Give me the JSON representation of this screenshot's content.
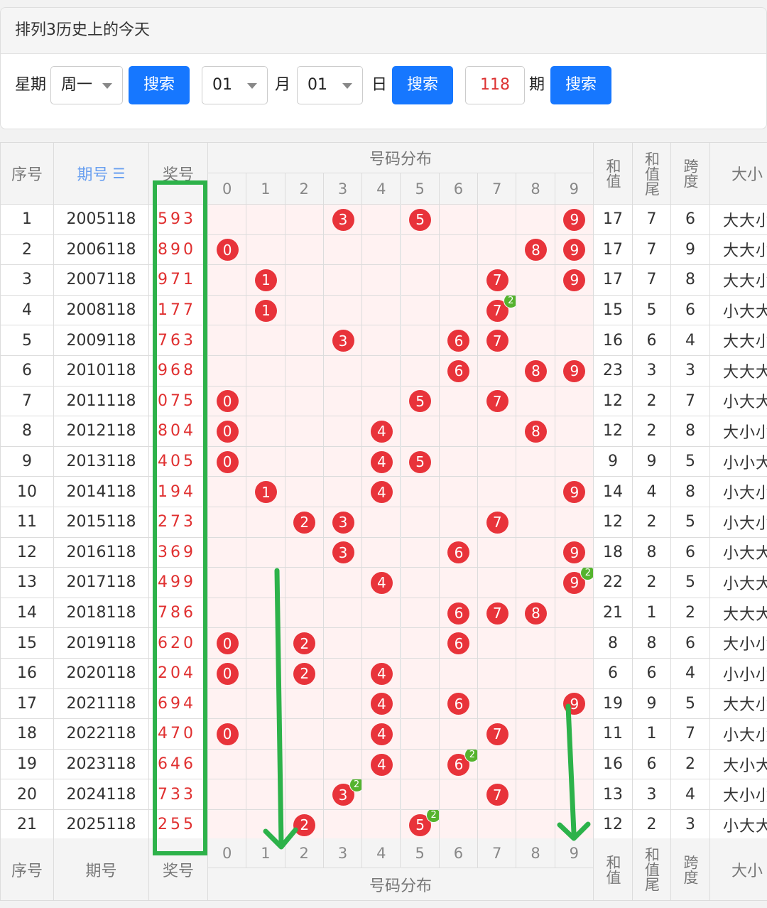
{
  "header": {
    "title": "排列3历史上的今天"
  },
  "toolbar": {
    "week_label": "星期",
    "week_value": "周一",
    "search_label": "搜索",
    "month_value": "01",
    "month_label": "月",
    "day_value": "01",
    "day_label": "日",
    "issue_value": "118",
    "issue_label": "期"
  },
  "table": {
    "headers": {
      "index": "序号",
      "period": "期号",
      "draw": "奖号",
      "distribution": "号码分布",
      "sum": "和值",
      "sum_tail": "和值尾",
      "span": "跨度",
      "size": "大小"
    },
    "digits": [
      "0",
      "1",
      "2",
      "3",
      "4",
      "5",
      "6",
      "7",
      "8",
      "9"
    ],
    "rows": [
      {
        "idx": "1",
        "period": "2005118",
        "draw": "593",
        "n": [
          5,
          9,
          3
        ],
        "sum": "17",
        "tail": "7",
        "span": "6",
        "size": "大大小"
      },
      {
        "idx": "2",
        "period": "2006118",
        "draw": "890",
        "n": [
          8,
          9,
          0
        ],
        "sum": "17",
        "tail": "7",
        "span": "9",
        "size": "大大小"
      },
      {
        "idx": "3",
        "period": "2007118",
        "draw": "971",
        "n": [
          9,
          7,
          1
        ],
        "sum": "17",
        "tail": "7",
        "span": "8",
        "size": "大大小"
      },
      {
        "idx": "4",
        "period": "2008118",
        "draw": "177",
        "n": [
          1,
          7,
          7
        ],
        "sum": "15",
        "tail": "5",
        "span": "6",
        "size": "小大大"
      },
      {
        "idx": "5",
        "period": "2009118",
        "draw": "763",
        "n": [
          7,
          6,
          3
        ],
        "sum": "16",
        "tail": "6",
        "span": "4",
        "size": "大大小"
      },
      {
        "idx": "6",
        "period": "2010118",
        "draw": "968",
        "n": [
          9,
          6,
          8
        ],
        "sum": "23",
        "tail": "3",
        "span": "3",
        "size": "大大大"
      },
      {
        "idx": "7",
        "period": "2011118",
        "draw": "075",
        "n": [
          0,
          7,
          5
        ],
        "sum": "12",
        "tail": "2",
        "span": "7",
        "size": "小大大"
      },
      {
        "idx": "8",
        "period": "2012118",
        "draw": "804",
        "n": [
          8,
          0,
          4
        ],
        "sum": "12",
        "tail": "2",
        "span": "8",
        "size": "大小小"
      },
      {
        "idx": "9",
        "period": "2013118",
        "draw": "405",
        "n": [
          4,
          0,
          5
        ],
        "sum": "9",
        "tail": "9",
        "span": "5",
        "size": "小小大"
      },
      {
        "idx": "10",
        "period": "2014118",
        "draw": "194",
        "n": [
          1,
          9,
          4
        ],
        "sum": "14",
        "tail": "4",
        "span": "8",
        "size": "小大小"
      },
      {
        "idx": "11",
        "period": "2015118",
        "draw": "273",
        "n": [
          2,
          7,
          3
        ],
        "sum": "12",
        "tail": "2",
        "span": "5",
        "size": "小大小"
      },
      {
        "idx": "12",
        "period": "2016118",
        "draw": "369",
        "n": [
          3,
          6,
          9
        ],
        "sum": "18",
        "tail": "8",
        "span": "6",
        "size": "小大大"
      },
      {
        "idx": "13",
        "period": "2017118",
        "draw": "499",
        "n": [
          4,
          9,
          9
        ],
        "sum": "22",
        "tail": "2",
        "span": "5",
        "size": "小大大"
      },
      {
        "idx": "14",
        "period": "2018118",
        "draw": "786",
        "n": [
          7,
          8,
          6
        ],
        "sum": "21",
        "tail": "1",
        "span": "2",
        "size": "大大大"
      },
      {
        "idx": "15",
        "period": "2019118",
        "draw": "620",
        "n": [
          6,
          2,
          0
        ],
        "sum": "8",
        "tail": "8",
        "span": "6",
        "size": "大小小"
      },
      {
        "idx": "16",
        "period": "2020118",
        "draw": "204",
        "n": [
          2,
          0,
          4
        ],
        "sum": "6",
        "tail": "6",
        "span": "4",
        "size": "小小小"
      },
      {
        "idx": "17",
        "period": "2021118",
        "draw": "694",
        "n": [
          6,
          9,
          4
        ],
        "sum": "19",
        "tail": "9",
        "span": "5",
        "size": "大大小"
      },
      {
        "idx": "18",
        "period": "2022118",
        "draw": "470",
        "n": [
          4,
          7,
          0
        ],
        "sum": "11",
        "tail": "1",
        "span": "7",
        "size": "小大小"
      },
      {
        "idx": "19",
        "period": "2023118",
        "draw": "646",
        "n": [
          6,
          4,
          6
        ],
        "sum": "16",
        "tail": "6",
        "span": "2",
        "size": "大小大"
      },
      {
        "idx": "20",
        "period": "2024118",
        "draw": "733",
        "n": [
          7,
          3,
          3
        ],
        "sum": "13",
        "tail": "3",
        "span": "4",
        "size": "大小小"
      },
      {
        "idx": "21",
        "period": "2025118",
        "draw": "255",
        "n": [
          2,
          5,
          5
        ],
        "sum": "12",
        "tail": "2",
        "span": "3",
        "size": "小大大"
      }
    ],
    "repeat_badge": "2"
  },
  "colors": {
    "accent": "#1677ff",
    "ball": "#e8333a",
    "badge": "#55b32e",
    "annotation": "#2db24a"
  }
}
